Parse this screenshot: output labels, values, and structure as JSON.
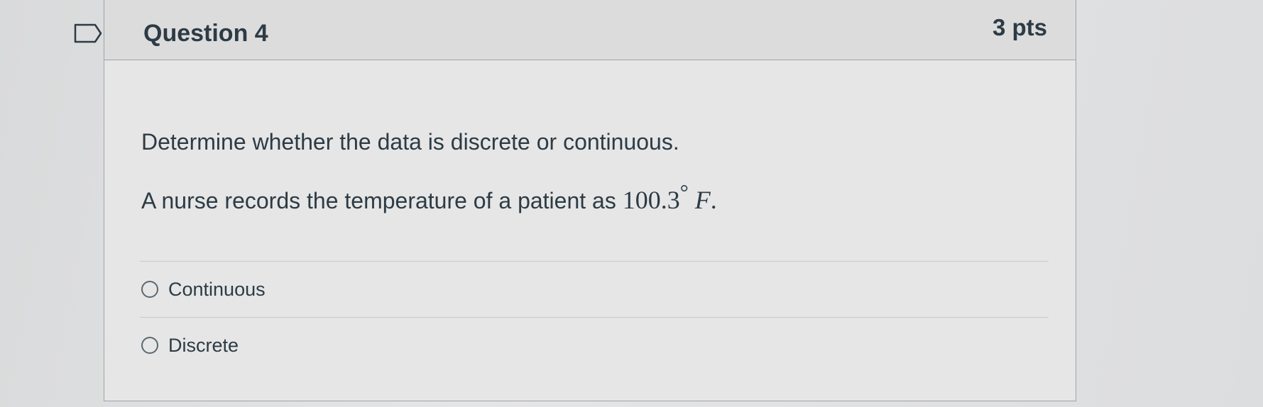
{
  "question": {
    "title": "Question 4",
    "points": "3 pts",
    "flag_icon": "flag-icon",
    "prompt_line1": "Determine whether the data is discrete or continuous.",
    "prompt_line2_text": "A nurse records the temperature of a patient as ",
    "prompt_line2_math_number": "100.3",
    "prompt_line2_math_degree": "°",
    "prompt_line2_math_var": "F",
    "prompt_line2_math_end": "."
  },
  "answers": [
    {
      "label": "Continuous",
      "selected": false
    },
    {
      "label": "Discrete",
      "selected": false
    }
  ],
  "colors": {
    "background": "#e1e2e3",
    "card": "#e6e6e6",
    "header": "#dcdcdd",
    "border": "#9fa4a8",
    "text": "#2d3b45"
  }
}
